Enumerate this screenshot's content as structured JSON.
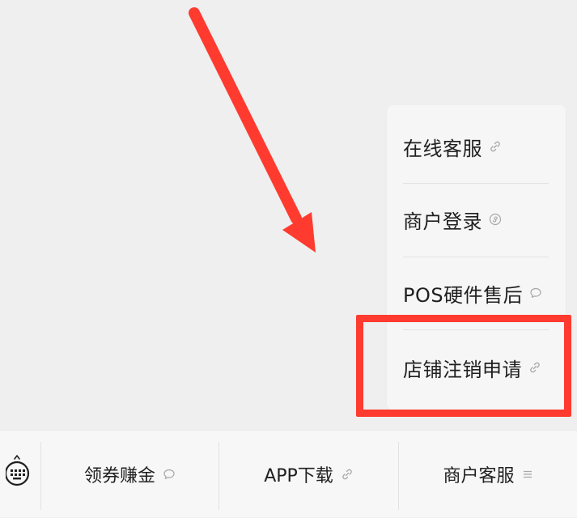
{
  "popup_menu": {
    "items": [
      {
        "label": "在线客服",
        "icon": "link-icon"
      },
      {
        "label": "商户登录",
        "icon": "mini-program-icon"
      },
      {
        "label": "POS硬件售后",
        "icon": "chat-bubble-icon"
      },
      {
        "label": "店铺注销申请",
        "icon": "link-icon"
      }
    ]
  },
  "bottom_bar": {
    "keyboard_icon": "keyboard-icon",
    "tabs": [
      {
        "label": "领券赚金",
        "icon": "chat-bubble-icon"
      },
      {
        "label": "APP下载",
        "icon": "link-icon"
      },
      {
        "label": "商户客服",
        "icon": "menu-icon"
      }
    ]
  },
  "annotations": {
    "arrow_color": "#ff3b30",
    "highlight_color": "#ff3b30"
  },
  "colors": {
    "background": "#efefef",
    "popup_background": "#f6f6f6",
    "text": "#1f1f1f",
    "icon_gray": "#a8a8a8"
  }
}
